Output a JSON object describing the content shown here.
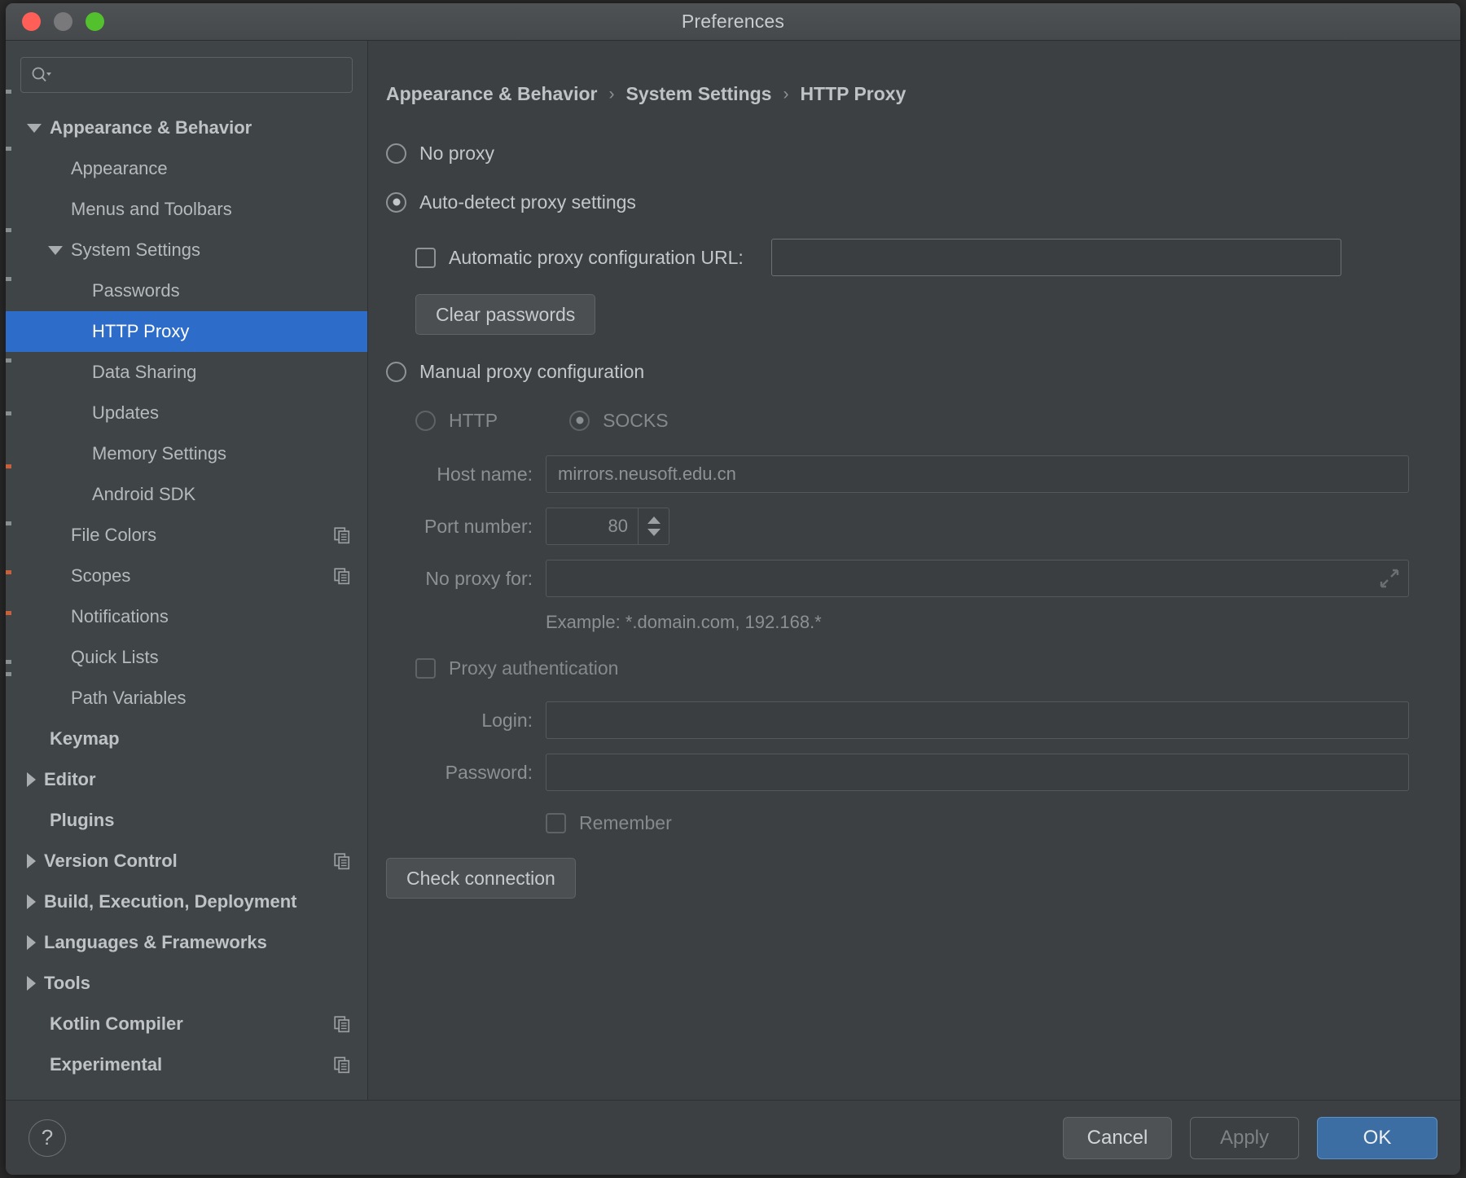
{
  "window": {
    "title": "Preferences",
    "traffic_lights": [
      "close-button",
      "minimize-button",
      "zoom-button"
    ]
  },
  "sidebar": {
    "search": {
      "placeholder": "",
      "value": "",
      "icon": "search-icon"
    },
    "items": [
      {
        "label": "Appearance & Behavior",
        "indent": 0,
        "twisty": "down",
        "bold": true,
        "selected": false,
        "copy": false
      },
      {
        "label": "Appearance",
        "indent": 1,
        "twisty": "none",
        "bold": false,
        "selected": false,
        "copy": false
      },
      {
        "label": "Menus and Toolbars",
        "indent": 1,
        "twisty": "none",
        "bold": false,
        "selected": false,
        "copy": false
      },
      {
        "label": "System Settings",
        "indent": 1,
        "twisty": "down",
        "bold": false,
        "selected": false,
        "copy": false
      },
      {
        "label": "Passwords",
        "indent": 2,
        "twisty": "none",
        "bold": false,
        "selected": false,
        "copy": false
      },
      {
        "label": "HTTP Proxy",
        "indent": 2,
        "twisty": "none",
        "bold": false,
        "selected": true,
        "copy": false
      },
      {
        "label": "Data Sharing",
        "indent": 2,
        "twisty": "none",
        "bold": false,
        "selected": false,
        "copy": false
      },
      {
        "label": "Updates",
        "indent": 2,
        "twisty": "none",
        "bold": false,
        "selected": false,
        "copy": false
      },
      {
        "label": "Memory Settings",
        "indent": 2,
        "twisty": "none",
        "bold": false,
        "selected": false,
        "copy": false
      },
      {
        "label": "Android SDK",
        "indent": 2,
        "twisty": "none",
        "bold": false,
        "selected": false,
        "copy": false
      },
      {
        "label": "File Colors",
        "indent": 1,
        "twisty": "none",
        "bold": false,
        "selected": false,
        "copy": true
      },
      {
        "label": "Scopes",
        "indent": 1,
        "twisty": "none",
        "bold": false,
        "selected": false,
        "copy": true
      },
      {
        "label": "Notifications",
        "indent": 1,
        "twisty": "none",
        "bold": false,
        "selected": false,
        "copy": false
      },
      {
        "label": "Quick Lists",
        "indent": 1,
        "twisty": "none",
        "bold": false,
        "selected": false,
        "copy": false
      },
      {
        "label": "Path Variables",
        "indent": 1,
        "twisty": "none",
        "bold": false,
        "selected": false,
        "copy": false
      },
      {
        "label": "Keymap",
        "indent": 0,
        "twisty": "none",
        "bold": true,
        "selected": false,
        "copy": false
      },
      {
        "label": "Editor",
        "indent": 0,
        "twisty": "right",
        "bold": true,
        "selected": false,
        "copy": false
      },
      {
        "label": "Plugins",
        "indent": 0,
        "twisty": "none",
        "bold": true,
        "selected": false,
        "copy": false
      },
      {
        "label": "Version Control",
        "indent": 0,
        "twisty": "right",
        "bold": true,
        "selected": false,
        "copy": true
      },
      {
        "label": "Build, Execution, Deployment",
        "indent": 0,
        "twisty": "right",
        "bold": true,
        "selected": false,
        "copy": false
      },
      {
        "label": "Languages & Frameworks",
        "indent": 0,
        "twisty": "right",
        "bold": true,
        "selected": false,
        "copy": false
      },
      {
        "label": "Tools",
        "indent": 0,
        "twisty": "right",
        "bold": true,
        "selected": false,
        "copy": false
      },
      {
        "label": "Kotlin Compiler",
        "indent": 0,
        "twisty": "none",
        "bold": true,
        "selected": false,
        "copy": true
      },
      {
        "label": "Experimental",
        "indent": 0,
        "twisty": "none",
        "bold": true,
        "selected": false,
        "copy": true
      }
    ]
  },
  "breadcrumb": {
    "items": [
      "Appearance & Behavior",
      "System Settings",
      "HTTP Proxy"
    ],
    "separator": "›"
  },
  "main": {
    "no_proxy": {
      "label": "No proxy",
      "checked": false
    },
    "auto_detect": {
      "label": "Auto-detect proxy settings",
      "checked": true
    },
    "pac_url": {
      "label": "Automatic proxy configuration URL:",
      "checked": false,
      "value": ""
    },
    "clear_passwords_button": "Clear passwords",
    "manual_proxy": {
      "label": "Manual proxy configuration",
      "checked": false
    },
    "proxy_type": {
      "http": {
        "label": "HTTP",
        "checked": false
      },
      "socks": {
        "label": "SOCKS",
        "checked": true
      }
    },
    "host_name": {
      "label": "Host name:",
      "value": "mirrors.neusoft.edu.cn"
    },
    "port_number": {
      "label": "Port number:",
      "value": "80"
    },
    "no_proxy_for": {
      "label": "No proxy for:",
      "value": "",
      "expand_icon": "expand-icon"
    },
    "example_hint": "Example: *.domain.com, 192.168.*",
    "proxy_auth": {
      "label": "Proxy authentication",
      "checked": false
    },
    "login": {
      "label": "Login:",
      "value": ""
    },
    "password": {
      "label": "Password:",
      "value": ""
    },
    "remember": {
      "label": "Remember",
      "checked": false
    },
    "check_connection_button": "Check connection"
  },
  "footer": {
    "help_label": "?",
    "cancel_label": "Cancel",
    "apply_label": "Apply",
    "ok_label": "OK"
  },
  "colors": {
    "accent_selection": "#2d6cc9",
    "ok_button": "#3d6ea3",
    "window_bg": "#3c4043",
    "sidebar_bg": "#3f4447"
  }
}
